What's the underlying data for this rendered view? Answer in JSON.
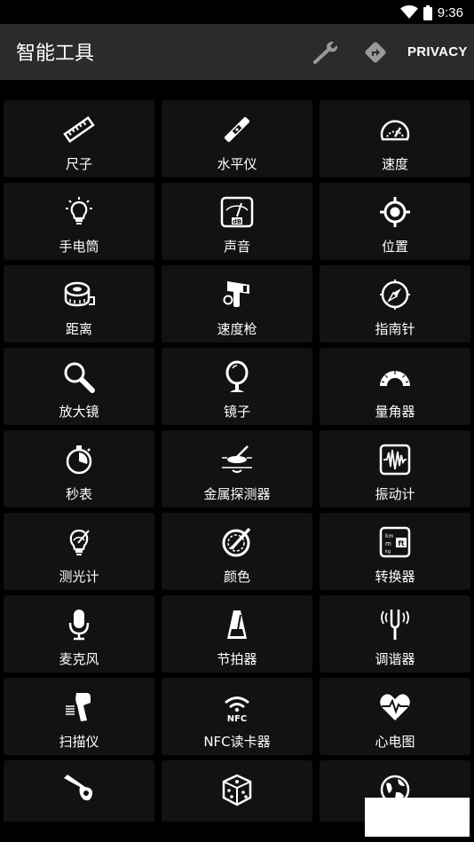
{
  "status": {
    "time": "9:36"
  },
  "app_bar": {
    "title": "智能工具",
    "privacy_label": "PRIVACY"
  },
  "tools": [
    {
      "label": "尺子",
      "icon": "ruler-icon"
    },
    {
      "label": "水平仪",
      "icon": "level-icon"
    },
    {
      "label": "速度",
      "icon": "speedometer-icon"
    },
    {
      "label": "手电筒",
      "icon": "bulb-icon"
    },
    {
      "label": "声音",
      "icon": "decibel-meter-icon"
    },
    {
      "label": "位置",
      "icon": "gps-target-icon"
    },
    {
      "label": "距离",
      "icon": "tape-measure-icon"
    },
    {
      "label": "速度枪",
      "icon": "speed-gun-icon"
    },
    {
      "label": "指南针",
      "icon": "compass-icon"
    },
    {
      "label": "放大镜",
      "icon": "magnifier-icon"
    },
    {
      "label": "镜子",
      "icon": "mirror-icon"
    },
    {
      "label": "量角器",
      "icon": "protractor-icon"
    },
    {
      "label": "秒表",
      "icon": "stopwatch-icon"
    },
    {
      "label": "金属探测器",
      "icon": "metal-detector-icon"
    },
    {
      "label": "振动计",
      "icon": "vibration-meter-icon"
    },
    {
      "label": "测光计",
      "icon": "light-meter-icon"
    },
    {
      "label": "颜色",
      "icon": "color-picker-icon"
    },
    {
      "label": "转换器",
      "icon": "unit-converter-icon"
    },
    {
      "label": "麦克风",
      "icon": "microphone-icon"
    },
    {
      "label": "节拍器",
      "icon": "metronome-icon"
    },
    {
      "label": "调谐器",
      "icon": "tuning-fork-icon"
    },
    {
      "label": "扫描仪",
      "icon": "barcode-scanner-icon"
    },
    {
      "label": "NFC读卡器",
      "icon": "nfc-icon"
    },
    {
      "label": "心电图",
      "icon": "heart-rate-icon"
    },
    {
      "label": "",
      "icon": "whistle-icon"
    },
    {
      "label": "",
      "icon": "dice-icon"
    },
    {
      "label": "",
      "icon": "globe-icon"
    }
  ]
}
